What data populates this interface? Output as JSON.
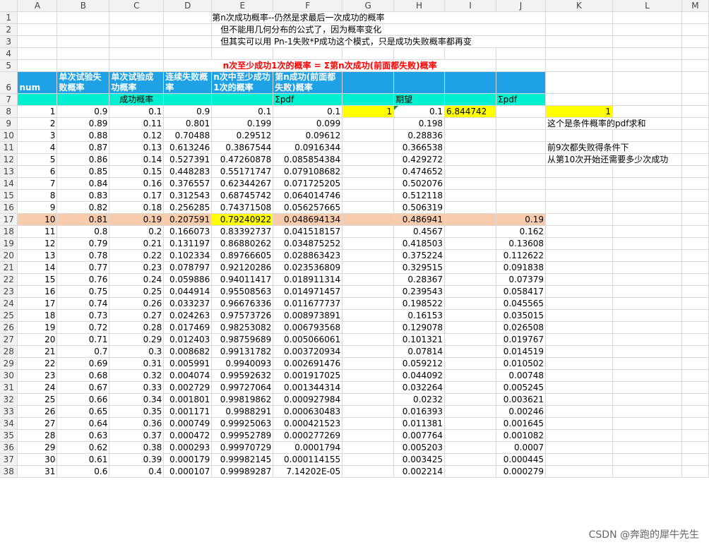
{
  "columns": [
    "A",
    "B",
    "C",
    "D",
    "E",
    "F",
    "G",
    "H",
    "I",
    "J",
    "K",
    "L",
    "M"
  ],
  "notes": {
    "r1": "第n次成功概率--仍然是求最后一次成功的概率",
    "r2": "但不能用几何分布的公式了，因为概率变化",
    "r3": "但其实可以用 Pn-1失败*P成功这个模式，只是成功失败概率都再变",
    "r5": "n次至少成功1次的概率 = Σ第n次成功(前面都失败)概率",
    "k9": "这个是条件概率的pdf求和",
    "k11": "前9次都失败得条件下",
    "k12": "从第10次开始还需要多少次成功"
  },
  "headers": {
    "num": "num",
    "b": "单次试验失败概率",
    "c": "单次试验成功概率",
    "d": "连续失败概率",
    "e": "n次中至少成功1次的概率",
    "f": "第n成功(前面都失败)概率"
  },
  "row7": {
    "c": "成功概率",
    "g": "Σpdf",
    "i": "期望",
    "k": "Σpdf"
  },
  "row8": {
    "g": "1",
    "h": "0.1",
    "i": "6.844742",
    "k": "1"
  },
  "rows": [
    {
      "n": "1",
      "b": "0.9",
      "c": "0.1",
      "d": "0.9",
      "e": "0.1",
      "f": "0.1",
      "h": "",
      "j": ""
    },
    {
      "n": "2",
      "b": "0.89",
      "c": "0.11",
      "d": "0.801",
      "e": "0.199",
      "f": "0.099",
      "h": "0.198",
      "j": ""
    },
    {
      "n": "3",
      "b": "0.88",
      "c": "0.12",
      "d": "0.70488",
      "e": "0.29512",
      "f": "0.09612",
      "h": "0.28836",
      "j": ""
    },
    {
      "n": "4",
      "b": "0.87",
      "c": "0.13",
      "d": "0.613246",
      "e": "0.3867544",
      "f": "0.0916344",
      "h": "0.366538",
      "j": ""
    },
    {
      "n": "5",
      "b": "0.86",
      "c": "0.14",
      "d": "0.527391",
      "e": "0.47260878",
      "f": "0.085854384",
      "h": "0.429272",
      "j": ""
    },
    {
      "n": "6",
      "b": "0.85",
      "c": "0.15",
      "d": "0.448283",
      "e": "0.55171747",
      "f": "0.079108682",
      "h": "0.474652",
      "j": ""
    },
    {
      "n": "7",
      "b": "0.84",
      "c": "0.16",
      "d": "0.376557",
      "e": "0.62344267",
      "f": "0.071725205",
      "h": "0.502076",
      "j": ""
    },
    {
      "n": "8",
      "b": "0.83",
      "c": "0.17",
      "d": "0.312543",
      "e": "0.68745742",
      "f": "0.064014746",
      "h": "0.512118",
      "j": ""
    },
    {
      "n": "9",
      "b": "0.82",
      "c": "0.18",
      "d": "0.256285",
      "e": "0.74371508",
      "f": "0.056257665",
      "h": "0.506319",
      "j": ""
    },
    {
      "n": "10",
      "b": "0.81",
      "c": "0.19",
      "d": "0.207591",
      "e": "0.79240922",
      "f": "0.048694134",
      "h": "0.486941",
      "j": "0.19"
    },
    {
      "n": "11",
      "b": "0.8",
      "c": "0.2",
      "d": "0.166073",
      "e": "0.83392737",
      "f": "0.041518157",
      "h": "0.4567",
      "j": "0.162"
    },
    {
      "n": "12",
      "b": "0.79",
      "c": "0.21",
      "d": "0.131197",
      "e": "0.86880262",
      "f": "0.034875252",
      "h": "0.418503",
      "j": "0.13608"
    },
    {
      "n": "13",
      "b": "0.78",
      "c": "0.22",
      "d": "0.102334",
      "e": "0.89766605",
      "f": "0.028863423",
      "h": "0.375224",
      "j": "0.112622"
    },
    {
      "n": "14",
      "b": "0.77",
      "c": "0.23",
      "d": "0.078797",
      "e": "0.92120286",
      "f": "0.023536809",
      "h": "0.329515",
      "j": "0.091838"
    },
    {
      "n": "15",
      "b": "0.76",
      "c": "0.24",
      "d": "0.059886",
      "e": "0.94011417",
      "f": "0.018911314",
      "h": "0.28367",
      "j": "0.07379"
    },
    {
      "n": "16",
      "b": "0.75",
      "c": "0.25",
      "d": "0.044914",
      "e": "0.95508563",
      "f": "0.014971457",
      "h": "0.239543",
      "j": "0.058417"
    },
    {
      "n": "17",
      "b": "0.74",
      "c": "0.26",
      "d": "0.033237",
      "e": "0.96676336",
      "f": "0.011677737",
      "h": "0.198522",
      "j": "0.045565"
    },
    {
      "n": "18",
      "b": "0.73",
      "c": "0.27",
      "d": "0.024263",
      "e": "0.97573726",
      "f": "0.008973891",
      "h": "0.16153",
      "j": "0.035015"
    },
    {
      "n": "19",
      "b": "0.72",
      "c": "0.28",
      "d": "0.017469",
      "e": "0.98253082",
      "f": "0.006793568",
      "h": "0.129078",
      "j": "0.026508"
    },
    {
      "n": "20",
      "b": "0.71",
      "c": "0.29",
      "d": "0.012403",
      "e": "0.98759689",
      "f": "0.005066061",
      "h": "0.101321",
      "j": "0.019767"
    },
    {
      "n": "21",
      "b": "0.7",
      "c": "0.3",
      "d": "0.008682",
      "e": "0.99131782",
      "f": "0.003720934",
      "h": "0.07814",
      "j": "0.014519"
    },
    {
      "n": "22",
      "b": "0.69",
      "c": "0.31",
      "d": "0.005991",
      "e": "0.9940093",
      "f": "0.002691476",
      "h": "0.059212",
      "j": "0.010502"
    },
    {
      "n": "23",
      "b": "0.68",
      "c": "0.32",
      "d": "0.004074",
      "e": "0.99592632",
      "f": "0.001917025",
      "h": "0.044092",
      "j": "0.00748"
    },
    {
      "n": "24",
      "b": "0.67",
      "c": "0.33",
      "d": "0.002729",
      "e": "0.99727064",
      "f": "0.001344314",
      "h": "0.032264",
      "j": "0.005245"
    },
    {
      "n": "25",
      "b": "0.66",
      "c": "0.34",
      "d": "0.001801",
      "e": "0.99819862",
      "f": "0.000927984",
      "h": "0.0232",
      "j": "0.003621"
    },
    {
      "n": "26",
      "b": "0.65",
      "c": "0.35",
      "d": "0.001171",
      "e": "0.9988291",
      "f": "0.000630483",
      "h": "0.016393",
      "j": "0.00246"
    },
    {
      "n": "27",
      "b": "0.64",
      "c": "0.36",
      "d": "0.000749",
      "e": "0.99925063",
      "f": "0.000421523",
      "h": "0.011381",
      "j": "0.001645"
    },
    {
      "n": "28",
      "b": "0.63",
      "c": "0.37",
      "d": "0.000472",
      "e": "0.99952789",
      "f": "0.000277269",
      "h": "0.007764",
      "j": "0.001082"
    },
    {
      "n": "29",
      "b": "0.62",
      "c": "0.38",
      "d": "0.000293",
      "e": "0.99970729",
      "f": "0.0001794",
      "h": "0.005203",
      "j": "0.0007"
    },
    {
      "n": "30",
      "b": "0.61",
      "c": "0.39",
      "d": "0.000179",
      "e": "0.99982145",
      "f": "0.000114155",
      "h": "0.003425",
      "j": "0.000445"
    },
    {
      "n": "31",
      "b": "0.6",
      "c": "0.4",
      "d": "0.000107",
      "e": "0.99989287",
      "f": "7.14202E-05",
      "h": "0.002214",
      "j": "0.000279"
    }
  ],
  "watermark": "CSDN @奔跑的犀牛先生",
  "colors": {
    "blue_header": "#1fa1e6",
    "cyan_row": "#00f0d0",
    "highlight_yellow": "#ffff00",
    "highlight_orange": "#f8cbad",
    "title_red": "#ff0000"
  }
}
